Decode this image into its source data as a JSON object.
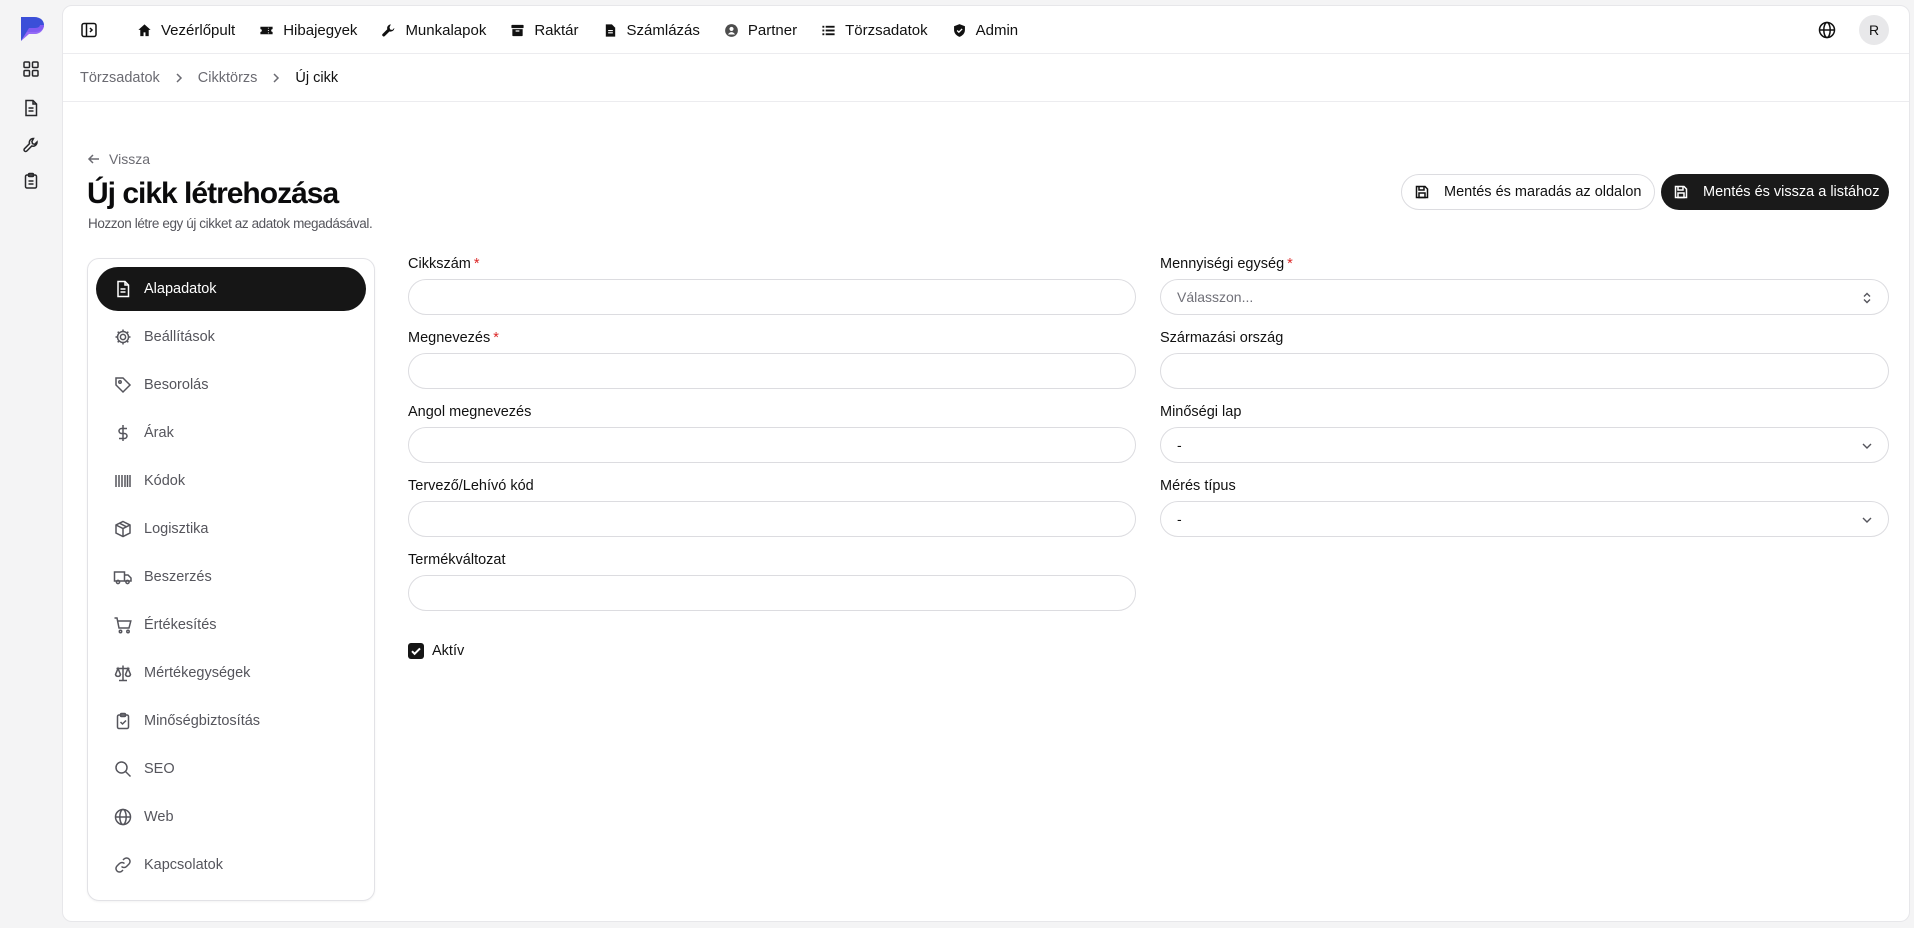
{
  "nav": {
    "items": [
      {
        "label": "Vezérlőpult",
        "icon": "home-icon"
      },
      {
        "label": "Hibajegyek",
        "icon": "ticket-icon"
      },
      {
        "label": "Munkalapok",
        "icon": "wrench-icon"
      },
      {
        "label": "Raktár",
        "icon": "archive-icon"
      },
      {
        "label": "Számlázás",
        "icon": "file-icon"
      },
      {
        "label": "Partner",
        "icon": "user-circle-icon"
      },
      {
        "label": "Törzsadatok",
        "icon": "list-icon"
      },
      {
        "label": "Admin",
        "icon": "shield-icon"
      }
    ],
    "avatar": "R"
  },
  "breadcrumb": [
    "Törzsadatok",
    "Cikktörzs",
    "Új cikk"
  ],
  "header": {
    "back": "Vissza",
    "title": "Új cikk létrehozása",
    "subtitle": "Hozzon létre egy új cikket az adatok megadásával.",
    "save_stay": "Mentés és maradás az oldalon",
    "save_back": "Mentés és vissza a listához"
  },
  "tabs": [
    {
      "label": "Alapadatok",
      "icon": "document-icon",
      "active": true
    },
    {
      "label": "Beállítások",
      "icon": "gear-icon",
      "active": false
    },
    {
      "label": "Besorolás",
      "icon": "tag-icon",
      "active": false
    },
    {
      "label": "Árak",
      "icon": "dollar-icon",
      "active": false
    },
    {
      "label": "Kódok",
      "icon": "barcode-icon",
      "active": false
    },
    {
      "label": "Logisztika",
      "icon": "package-icon",
      "active": false
    },
    {
      "label": "Beszerzés",
      "icon": "truck-icon",
      "active": false
    },
    {
      "label": "Értékesítés",
      "icon": "cart-icon",
      "active": false
    },
    {
      "label": "Mértékegységek",
      "icon": "scale-icon",
      "active": false
    },
    {
      "label": "Minőségbiztosítás",
      "icon": "clipboard-check-icon",
      "active": false
    },
    {
      "label": "SEO",
      "icon": "search-icon",
      "active": false
    },
    {
      "label": "Web",
      "icon": "globe-icon",
      "active": false
    },
    {
      "label": "Kapcsolatok",
      "icon": "link-icon",
      "active": false
    }
  ],
  "form": {
    "cikkszam": {
      "label": "Cikkszám",
      "value": ""
    },
    "megnevezes": {
      "label": "Megnevezés",
      "value": ""
    },
    "angol": {
      "label": "Angol megnevezés",
      "value": ""
    },
    "tervezo": {
      "label": "Tervező/Lehívó kód",
      "value": ""
    },
    "termekvaltozat": {
      "label": "Termékváltozat",
      "value": ""
    },
    "mennyisegi": {
      "label": "Mennyiségi egység",
      "placeholder": "Válasszon..."
    },
    "szarmazasi": {
      "label": "Származási ország",
      "value": ""
    },
    "minosegi": {
      "label": "Minőségi lap",
      "value": "-"
    },
    "meres": {
      "label": "Mérés típus",
      "value": "-"
    },
    "aktiv": {
      "label": "Aktív",
      "checked": true
    }
  },
  "colors": {
    "accent": "#161616",
    "required": "#dc2626",
    "logo_blue": "#3b4fd8",
    "logo_purple": "#8b5cf6"
  }
}
